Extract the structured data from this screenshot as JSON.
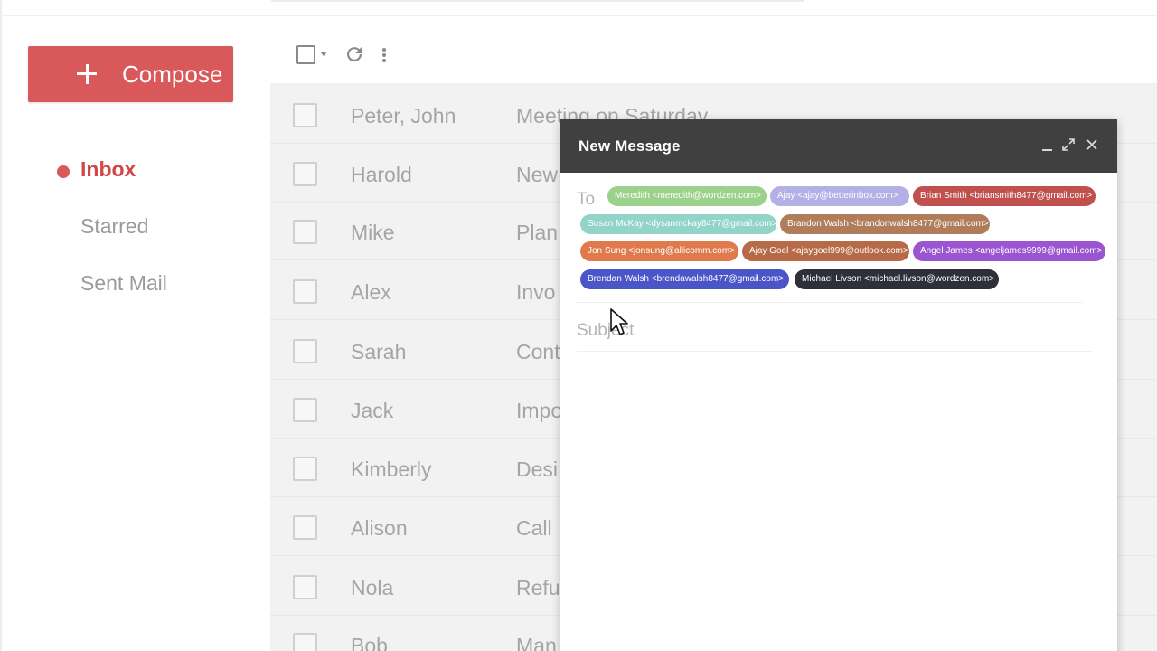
{
  "compose_button": {
    "label": "Compose"
  },
  "nav": [
    {
      "label": "Inbox",
      "active": true
    },
    {
      "label": "Starred",
      "active": false
    },
    {
      "label": "Sent Mail",
      "active": false
    }
  ],
  "toolbar": {
    "icons": [
      "checkbox-icon",
      "caret-down-icon",
      "refresh-icon",
      "more-vert-icon"
    ]
  },
  "emails": [
    {
      "sender": "Peter, John",
      "subject": "Meeting on Saturday"
    },
    {
      "sender": "Harold",
      "subject": "New"
    },
    {
      "sender": "Mike",
      "subject": "Plan"
    },
    {
      "sender": "Alex",
      "subject": "Invo"
    },
    {
      "sender": "Sarah",
      "subject": "Cont"
    },
    {
      "sender": "Jack",
      "subject": "Impo"
    },
    {
      "sender": "Kimberly",
      "subject": "Desi"
    },
    {
      "sender": "Alison",
      "subject": "Call"
    },
    {
      "sender": "Nola",
      "subject": "Refu"
    },
    {
      "sender": "Bob",
      "subject": "Man"
    }
  ],
  "compose_window": {
    "title": "New Message",
    "to_label": "To",
    "subject_placeholder": "Subject",
    "recipients": [
      {
        "text": "Meredith <meredith@wordzen.com>",
        "color": "#9bd18a"
      },
      {
        "text": "Ajay <ajay@betterinbox.com>",
        "color": "#b3b0e6"
      },
      {
        "text": "Brian Smith <briansmith8477@gmail.com>",
        "color": "#c0504d"
      },
      {
        "text": "Susan McKay <dysanmckay8477@gmail.com>",
        "color": "#93d4c8"
      },
      {
        "text": "Brandon Walsh <brandonwalsh8477@gmail.com>",
        "color": "#b07d5a"
      },
      {
        "text": "Jon Sung <jonsung@allicomm.com>",
        "color": "#e07a4d"
      },
      {
        "text": "Ajay Goel <ajaygoel999@outlook.com>",
        "color": "#b66a47"
      },
      {
        "text": "Angel James <angeljames9999@gmail.com>",
        "color": "#9b55d1"
      },
      {
        "text": "Brendan Walsh <brendawalsh8477@gmail.com>",
        "color": "#4a55c8"
      },
      {
        "text": "Michael Livson <michael.livson@wordzen.com>",
        "color": "#2f2f3a"
      }
    ]
  },
  "colors": {
    "accent": "#d9585a",
    "header": "#404040"
  }
}
